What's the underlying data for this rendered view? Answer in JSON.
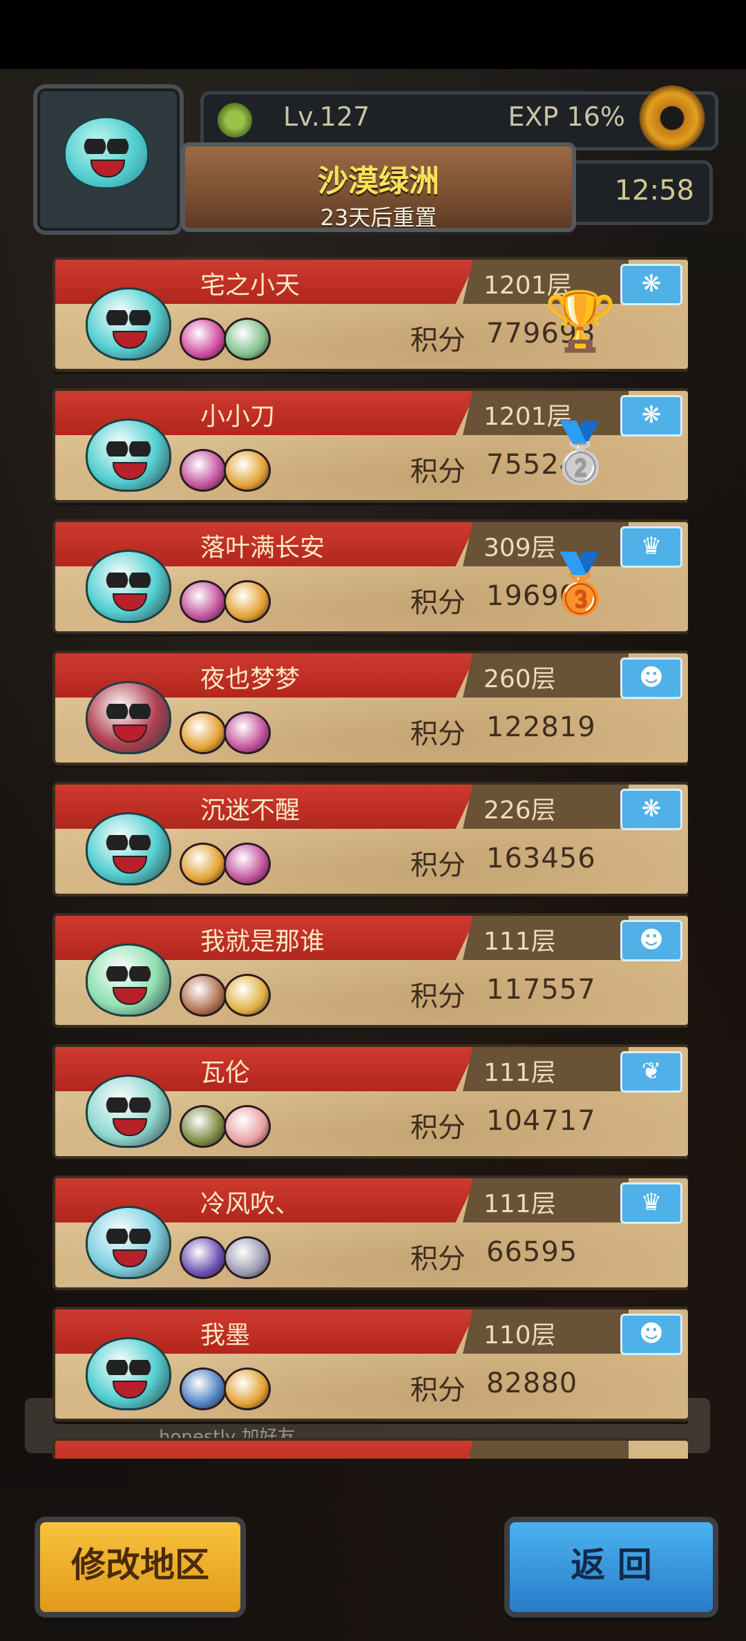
{
  "hud": {
    "level": "Lv.127",
    "exp": "EXP 16%",
    "time": "12:58",
    "season_title": "沙漠绿洲",
    "season_reset": "23天后重置"
  },
  "score_label": "积分",
  "rows": [
    {
      "name": "宅之小天",
      "floor": "1201层",
      "score": "779693",
      "rank": "gold",
      "badge": "❋",
      "main_color": "#54cfd0",
      "s1": "#d04aa0",
      "s2": "#7dc08a"
    },
    {
      "name": "小小刀",
      "floor": "1201层",
      "score": "755243",
      "rank": "silver",
      "badge": "❋",
      "main_color": "#54cfd0",
      "s1": "#c0509a",
      "s2": "#e2a030"
    },
    {
      "name": "落叶满长安",
      "floor": "309层",
      "score": "196908",
      "rank": "bronze",
      "badge": "♛",
      "main_color": "#54cfd0",
      "s1": "#c0509a",
      "s2": "#e2a030"
    },
    {
      "name": "夜也梦梦",
      "floor": "260层",
      "score": "122819",
      "rank": "",
      "badge": "☻",
      "main_color": "#b04050",
      "s1": "#e2a030",
      "s2": "#c0509a"
    },
    {
      "name": "沉迷不醒",
      "floor": "226层",
      "score": "163456",
      "rank": "",
      "badge": "❋",
      "main_color": "#54cfd0",
      "s1": "#e2a030",
      "s2": "#c0509a"
    },
    {
      "name": "我就是那谁",
      "floor": "111层",
      "score": "117557",
      "rank": "",
      "badge": "☻",
      "main_color": "#8fe0b0",
      "s1": "#b07050",
      "s2": "#e0b040"
    },
    {
      "name": "瓦伦",
      "floor": "111层",
      "score": "104717",
      "rank": "",
      "badge": "❦",
      "main_color": "#8fd8d0",
      "s1": "#7a8a40",
      "s2": "#e8a0a0"
    },
    {
      "name": "冷风吹、",
      "floor": "111层",
      "score": "66595",
      "rank": "",
      "badge": "♛",
      "main_color": "#7fd0e0",
      "s1": "#6a50b0",
      "s2": "#9a9ab0"
    },
    {
      "name": "我墨",
      "floor": "110层",
      "score": "82880",
      "rank": "",
      "badge": "☻",
      "main_color": "#54cfd0",
      "s1": "#4a80c0",
      "s2": "#e2a030"
    }
  ],
  "chat_hint": "honestly 加好友",
  "buttons": {
    "region": "修改地区",
    "back": "返 回"
  }
}
